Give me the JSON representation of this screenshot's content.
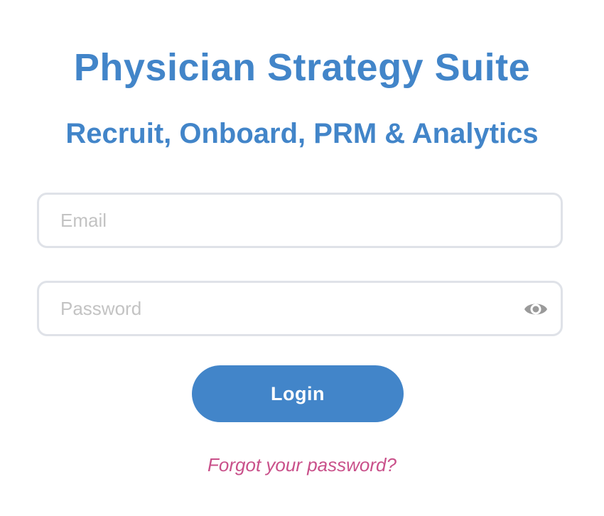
{
  "header": {
    "title": "Physician Strategy Suite",
    "subtitle": "Recruit, Onboard, PRM & Analytics"
  },
  "form": {
    "email_placeholder": "Email",
    "email_value": "",
    "password_placeholder": "Password",
    "password_value": "",
    "password_toggle_icon": "eye-icon",
    "login_label": "Login",
    "forgot_label": "Forgot your password?"
  },
  "colors": {
    "brand_blue": "#4285c9",
    "link_pink": "#c9508a",
    "field_border": "#dfe2e8",
    "placeholder_gray": "#c3c3c3",
    "icon_gray": "#9a9a9a"
  }
}
